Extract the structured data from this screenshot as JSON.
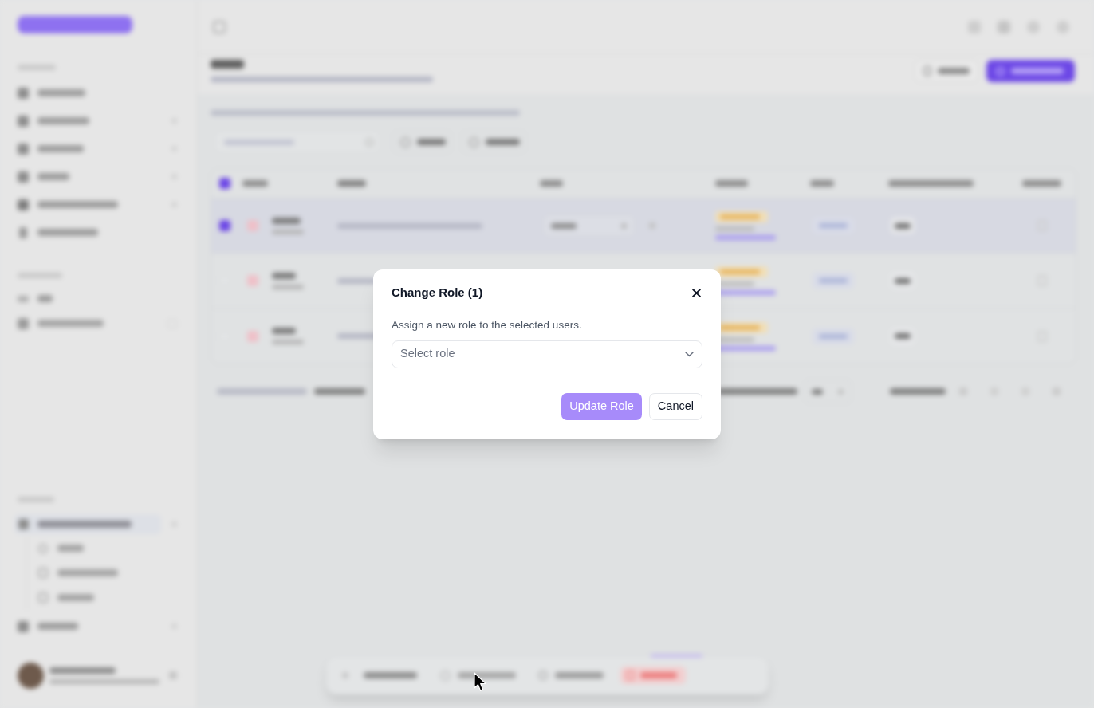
{
  "dialog": {
    "title": "Change Role (1)",
    "description": "Assign a new role to the selected users.",
    "role_select": {
      "placeholder": "Select role"
    },
    "buttons": [
      {
        "label": "Update Role",
        "kind": "primary",
        "disabled": true
      },
      {
        "label": "Cancel",
        "kind": "secondary",
        "disabled": false
      }
    ]
  }
}
